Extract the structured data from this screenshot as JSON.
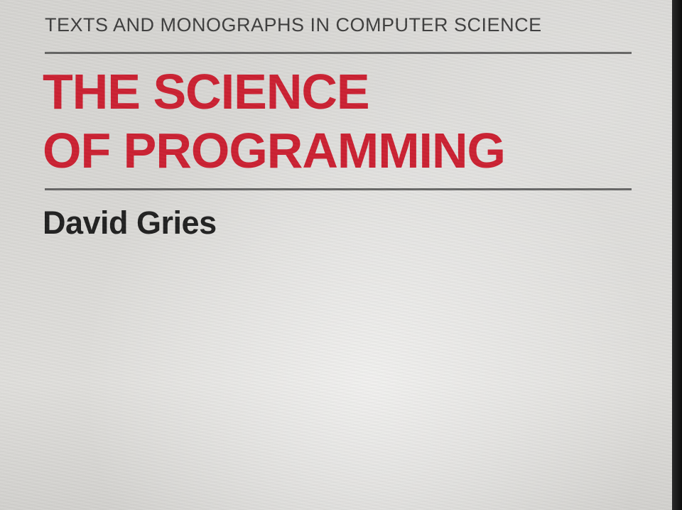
{
  "cover": {
    "series_title": "TEXTS AND MONOGRAPHS IN COMPUTER SCIENCE",
    "title_lines": [
      "THE SCIENCE",
      "OF PROGRAMMING"
    ],
    "author": "David Gries"
  },
  "colors": {
    "title": "#cc2233",
    "text": "#2b2b2b",
    "background": "#d9d8d5"
  }
}
